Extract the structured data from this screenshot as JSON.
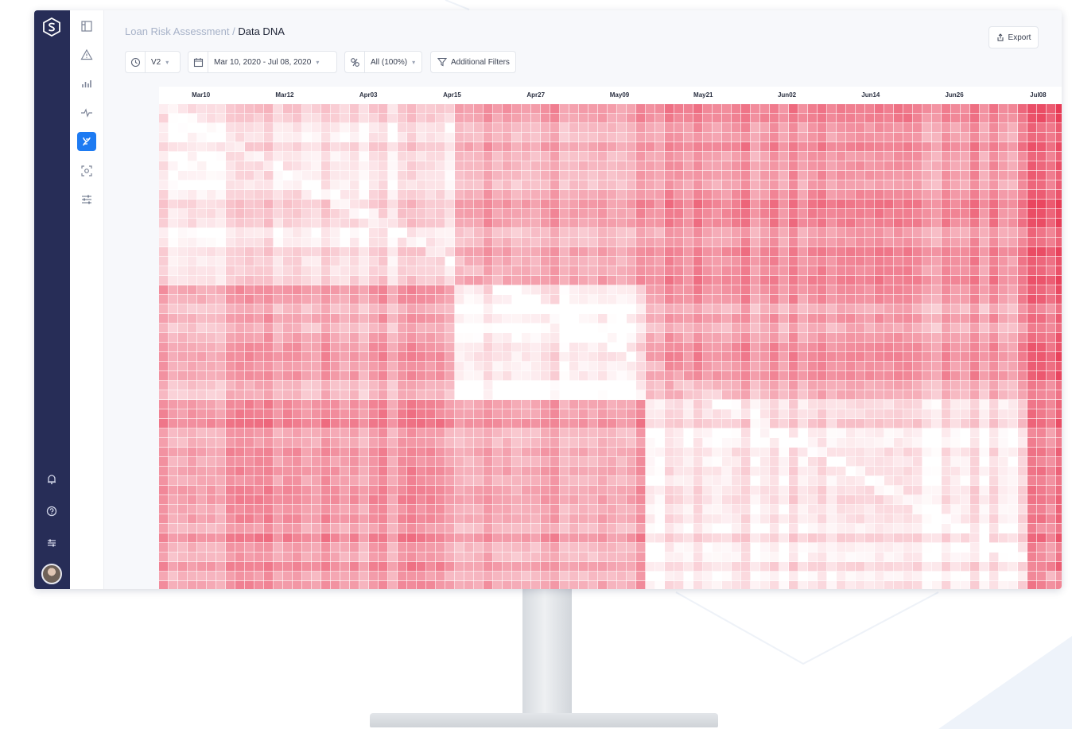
{
  "breadcrumb": {
    "parent": "Loan Risk Assessment",
    "separator": " / ",
    "current": "Data DNA"
  },
  "toolbar": {
    "version_value": "V2",
    "date_range": "Mar 10, 2020 - Jul 08, 2020",
    "segment_value": "All (100%)",
    "additional_filters_label": "Additional Filters",
    "export_label": "Export"
  },
  "colors": {
    "rail_bg": "#272d57",
    "accent": "#1e7bf2",
    "heat_high": "#e83a55",
    "heat_low": "#ffffff"
  },
  "icons": {
    "rail_top": "logo-icon",
    "rail_bottom": [
      "bell-icon",
      "help-icon",
      "settings-icon",
      "avatar"
    ],
    "subnav": [
      "dashboard-icon",
      "alert-triangle-icon",
      "bar-chart-icon",
      "activity-icon",
      "data-dna-icon",
      "scan-icon",
      "sliders-icon"
    ],
    "subnav_active": "data-dna-icon"
  },
  "chart_data": {
    "type": "heatmap",
    "x_tick_labels": [
      "Mar10",
      "Mar12",
      "Apr03",
      "Apr15",
      "Apr27",
      "May09",
      "May21",
      "Jun02",
      "Jun14",
      "Jun26",
      "Jul08"
    ],
    "blocks": [
      "Mar10-Apr14",
      "Apr15-May08",
      "May09-Jul01",
      "Jul02-Jul08"
    ],
    "block_distance": [
      [
        0.15,
        0.45,
        0.55,
        0.8
      ],
      [
        0.45,
        0.1,
        0.5,
        0.75
      ],
      [
        0.55,
        0.5,
        0.15,
        0.7
      ],
      [
        0.8,
        0.75,
        0.7,
        0.2
      ]
    ],
    "color_scale": [
      "#ffffff",
      "#e83a55"
    ]
  }
}
